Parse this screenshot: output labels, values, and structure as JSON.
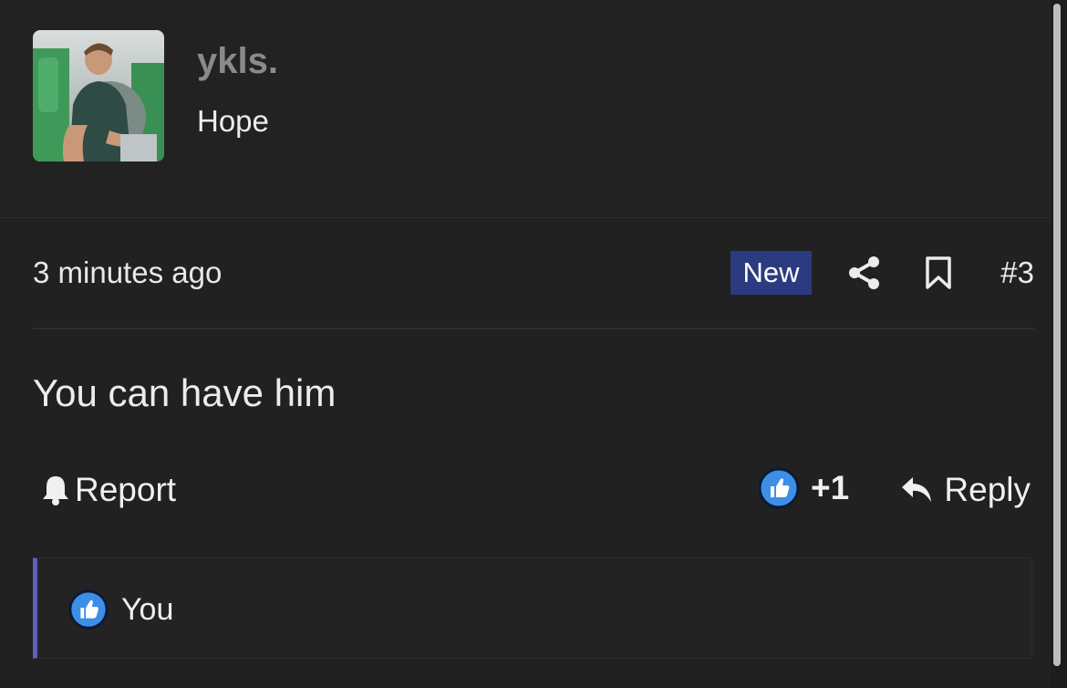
{
  "user": {
    "username": "ykls.",
    "title": "Hope",
    "avatar_alt": "user avatar"
  },
  "post": {
    "timestamp": "3 minutes ago",
    "badge": "New",
    "number": "#3",
    "body": "You can have him"
  },
  "actions": {
    "report_label": "Report",
    "reaction_count": "+1",
    "reply_label": "Reply"
  },
  "reactions_bar": {
    "users": "You"
  },
  "colors": {
    "background": "#212121",
    "badge": "#2b3b80",
    "like": "#3d8fe6",
    "accent_border": "#5b62b8"
  },
  "icons": {
    "report": "bell-icon",
    "share": "share-icon",
    "bookmark": "bookmark-icon",
    "like": "thumbs-up-icon",
    "reply": "reply-arrow-icon"
  }
}
